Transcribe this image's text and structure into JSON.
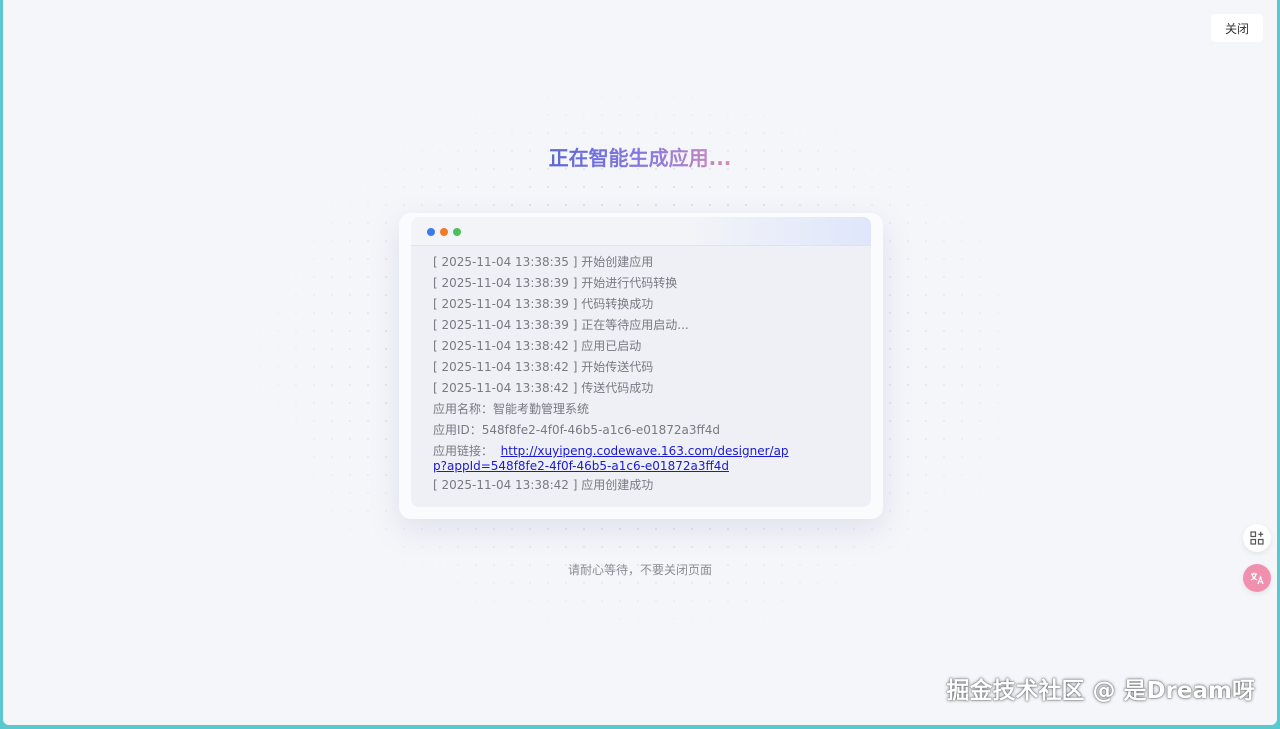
{
  "close_label": "关闭",
  "title": "正在智能生成应用...",
  "logs": [
    "[ 2025-11-04 13:38:35 ] 开始创建应用",
    "[ 2025-11-04 13:38:39 ] 开始进行代码转换",
    "[ 2025-11-04 13:38:39 ] 代码转换成功",
    "[ 2025-11-04 13:38:39 ] 正在等待应用启动...",
    "[ 2025-11-04 13:38:42 ] 应用已启动",
    "[ 2025-11-04 13:38:42 ] 开始传送代码",
    "[ 2025-11-04 13:38:42 ] 传送代码成功"
  ],
  "app_name_label": "应用名称：",
  "app_name": "智能考勤管理系统",
  "app_id_label": "应用ID：",
  "app_id": "548f8fe2-4f0f-46b5-a1c6-e01872a3ff4d",
  "app_link_label": "应用链接：",
  "app_link": "http://xuyipeng.codewave.163.com/designer/app?appId=548f8fe2-4f0f-46b5-a1c6-e01872a3ff4d",
  "final_log": "[ 2025-11-04 13:38:42 ] 应用创建成功",
  "hint": "请耐心等待，不要关闭页面",
  "watermark": "掘金技术社区 @ 是Dream呀",
  "icons": {
    "dot_colors": [
      "#3b7be9",
      "#f07a28",
      "#4cc05b"
    ],
    "side": [
      "apps-add-icon",
      "translate-icon"
    ]
  }
}
